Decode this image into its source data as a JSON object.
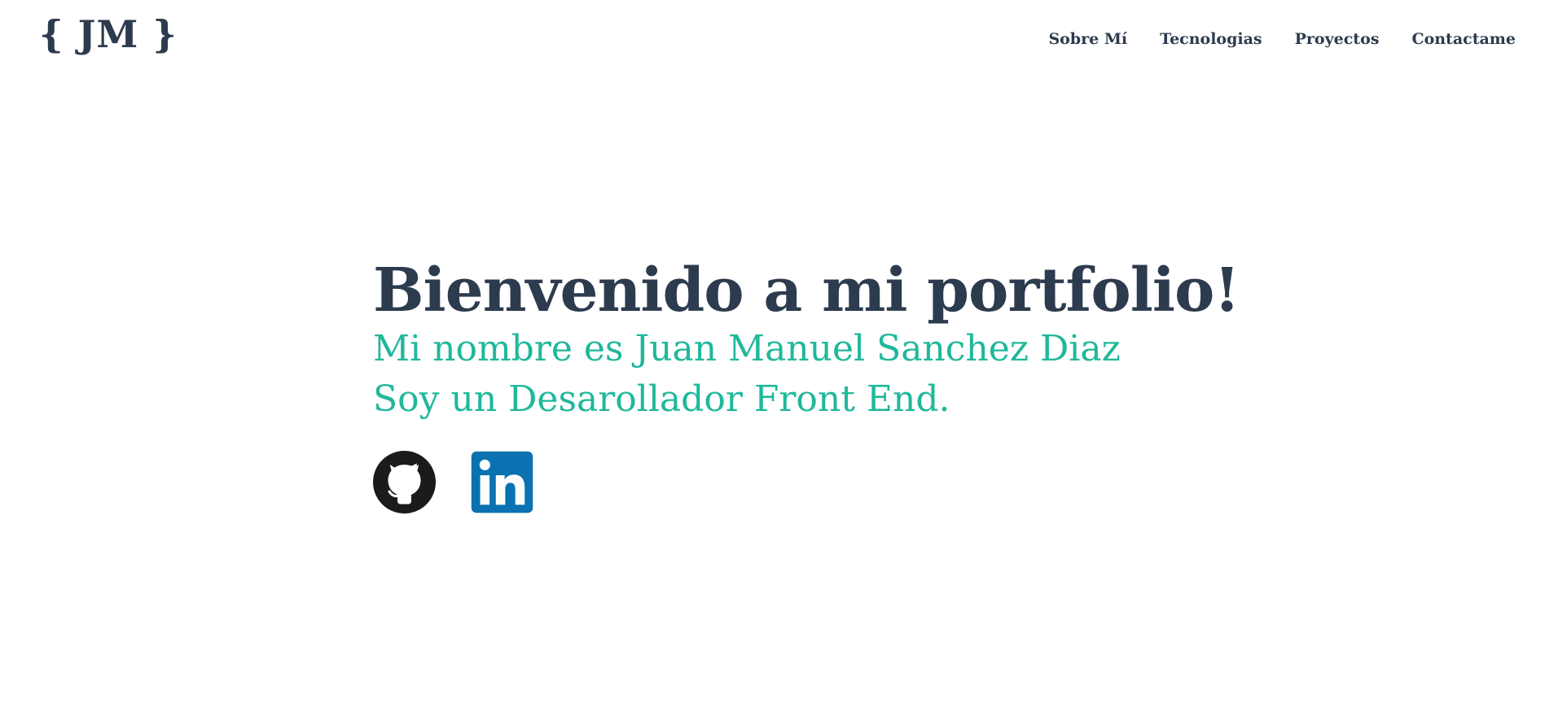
{
  "header": {
    "logo": "{ JM }",
    "nav": [
      {
        "label": "Sobre Mí"
      },
      {
        "label": "Tecnologias"
      },
      {
        "label": "Proyectos"
      },
      {
        "label": "Contactame"
      }
    ]
  },
  "hero": {
    "title": "Bienvenido a mi portfolio!",
    "line1": "Mi nombre es Juan Manuel Sanchez Diaz",
    "line2": "Soy un Desarollador Front End."
  },
  "social": [
    {
      "icon": "github-icon"
    },
    {
      "icon": "linkedin-icon"
    }
  ],
  "colors": {
    "text": "#2d3b4e",
    "accent": "#1fb89a",
    "linkedin": "#0a72b1",
    "github": "#1b1b1b"
  }
}
